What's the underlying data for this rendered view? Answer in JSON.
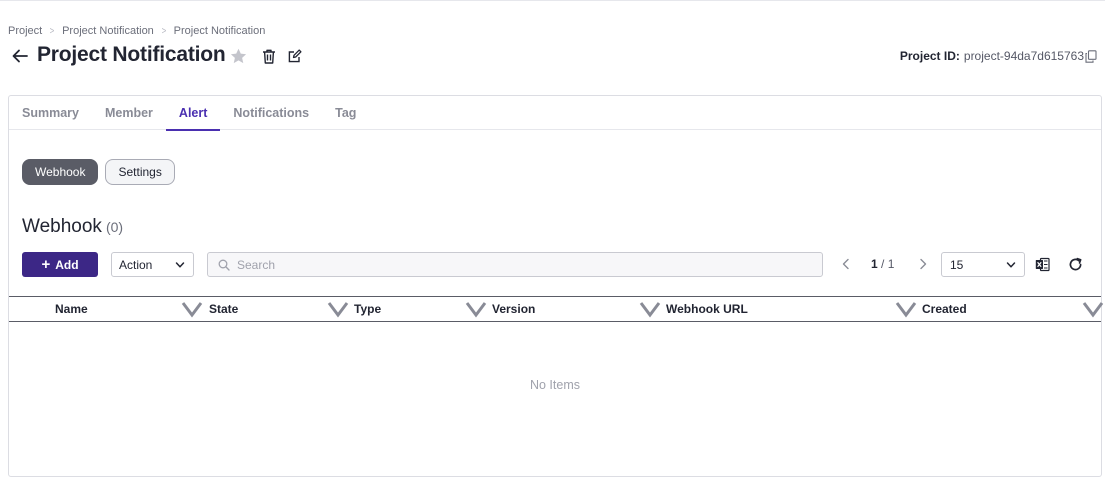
{
  "breadcrumb": [
    "Project",
    "Project Notification",
    "Project Notification"
  ],
  "header": {
    "title": "Project Notification",
    "project_id_label": "Project ID:",
    "project_id_value": "project-94da7d615763"
  },
  "tabs": [
    {
      "label": "Summary",
      "active": false
    },
    {
      "label": "Member",
      "active": false
    },
    {
      "label": "Alert",
      "active": true
    },
    {
      "label": "Notifications",
      "active": false
    },
    {
      "label": "Tag",
      "active": false
    }
  ],
  "segments": [
    {
      "label": "Webhook",
      "active": true
    },
    {
      "label": "Settings",
      "active": false
    }
  ],
  "section": {
    "title": "Webhook",
    "count": "(0)"
  },
  "toolbar": {
    "add_label": "Add",
    "action_label": "Action",
    "search_placeholder": "Search",
    "page_current": "1",
    "page_total": "/ 1",
    "page_size": "15"
  },
  "table": {
    "columns": [
      "Name",
      "State",
      "Type",
      "Version",
      "Webhook URL",
      "Created"
    ],
    "empty_text": "No Items"
  },
  "colors": {
    "accent": "#4a2fb0",
    "primary_button": "#3c2786",
    "segment_active": "#5a5c66"
  },
  "icons": [
    "arrow-left-icon",
    "star-icon",
    "trash-icon",
    "edit-icon",
    "copy-icon",
    "search-icon",
    "chevron-down-icon",
    "chevron-left-icon",
    "chevron-right-icon",
    "excel-icon",
    "refresh-icon",
    "sort-icon"
  ]
}
